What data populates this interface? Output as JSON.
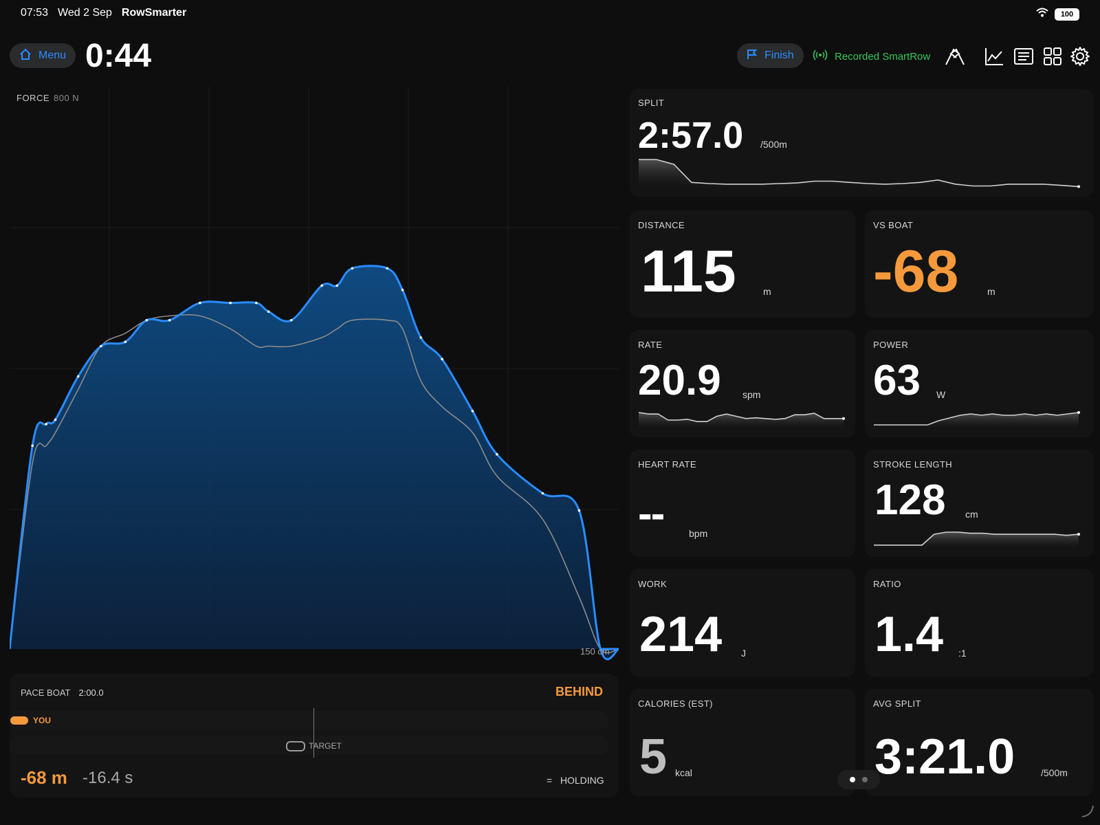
{
  "status_bar": {
    "time": "07:53",
    "date": "Wed 2 Sep",
    "app_name": "RowSmarter",
    "battery": "100"
  },
  "toolbar": {
    "menu_label": "Menu",
    "timer": "0:44",
    "finish_label": "Finish",
    "recorded_label": "Recorded SmartRow",
    "icons": [
      "race-flags-icon",
      "line-chart-icon",
      "list-icon",
      "grid-icon",
      "settings-icon"
    ]
  },
  "force_chart": {
    "label": "FORCE",
    "max_label": "800 N",
    "x_label": "150 cm",
    "chart_data": {
      "type": "area",
      "x": [
        0,
        15,
        24,
        30,
        45,
        60,
        76,
        90,
        105,
        125,
        145,
        162,
        170,
        185,
        205,
        215,
        225,
        248,
        258,
        270,
        284,
        304,
        320,
        350,
        374,
        388,
        400
      ],
      "series": [
        {
          "values": [
            0,
            470,
            520,
            530,
            630,
            700,
            710,
            760,
            760,
            800,
            800,
            800,
            780,
            760,
            840,
            840,
            880,
            880,
            830,
            720,
            670,
            550,
            450,
            360,
            320,
            0,
            0
          ]
        },
        {
          "values": [
            0,
            430,
            470,
            500,
            600,
            700,
            730,
            760,
            770,
            770,
            740,
            700,
            700,
            700,
            720,
            740,
            760,
            760,
            740,
            620,
            560,
            500,
            400,
            300,
            120,
            0,
            0
          ]
        }
      ],
      "x_max": 400,
      "y_max": 1300,
      "colors": [
        "#2a8cff",
        "#8c8c8c"
      ]
    }
  },
  "pace_boat": {
    "title": "PACE BOAT",
    "pace": "2:00.0",
    "status": "BEHIND",
    "you_label": "YOU",
    "target_label": "TARGET",
    "distance_delta": "-68 m",
    "time_delta": "-16.4 s",
    "trend": "=",
    "trend_label": "HOLDING"
  },
  "metrics": {
    "split": {
      "label": "SPLIT",
      "value": "2:57.0",
      "unit": "/500m",
      "spark": [
        48,
        48,
        40,
        10,
        8,
        7,
        7,
        7,
        8,
        9,
        12,
        12,
        10,
        8,
        7,
        8,
        10,
        14,
        7,
        4,
        4,
        7,
        7,
        7,
        5,
        3
      ]
    },
    "distance": {
      "label": "DISTANCE",
      "value": "115",
      "unit": "m"
    },
    "vs_boat": {
      "label": "VS BOAT",
      "value": "-68",
      "unit": "m",
      "color": "#f59a3c"
    },
    "rate": {
      "label": "RATE",
      "value": "20.9",
      "unit": "spm",
      "spark": [
        20,
        18,
        18,
        10,
        10,
        11,
        8,
        8,
        15,
        18,
        15,
        12,
        13,
        12,
        11,
        12,
        17,
        17,
        19,
        12,
        12,
        12
      ]
    },
    "power": {
      "label": "POWER",
      "value": "63",
      "unit": "W",
      "spark": [
        2,
        2,
        2,
        2,
        2,
        2,
        5,
        7,
        9,
        10,
        9,
        10,
        9,
        9,
        10,
        9,
        10,
        9,
        10,
        11
      ]
    },
    "heart_rate": {
      "label": "HEART RATE",
      "value": "--",
      "unit": "bpm"
    },
    "stroke_length": {
      "label": "STROKE LENGTH",
      "value": "128",
      "unit": "cm",
      "spark": [
        2,
        2,
        2,
        2,
        2,
        12,
        14,
        14,
        13,
        13,
        12,
        12,
        12,
        12,
        12,
        12,
        11,
        12
      ]
    },
    "work": {
      "label": "WORK",
      "value": "214",
      "unit": "J"
    },
    "ratio": {
      "label": "RATIO",
      "value": "1.4",
      "unit": ":1"
    },
    "calories": {
      "label": "CALORIES (EST)",
      "value": "5",
      "unit": "kcal"
    },
    "avg_split": {
      "label": "AVG SPLIT",
      "value": "3:21.0",
      "unit": "/500m"
    }
  },
  "pager": {
    "pages": 2,
    "current": 1
  }
}
